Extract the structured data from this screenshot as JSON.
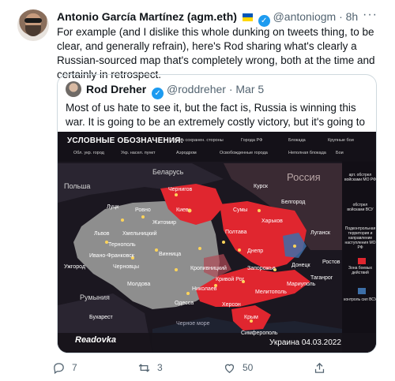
{
  "tweet": {
    "author_name": "Antonio García Martínez (agm.eth)",
    "handle": "@antoniogm",
    "separator": "·",
    "time": "8h",
    "body": "For example (and I dislike this whole dunking on tweets thing, to be clear, and generally refrain), here's Rod sharing what's clearly a Russian-sourced map that's completely wrong, both at the time and certainly in retrospect."
  },
  "quote": {
    "author_name": "Rod Dreher",
    "handle": "@roddreher",
    "separator": "·",
    "time": "Mar 5",
    "body": "Most of us hate to see it, but the fact is, Russia is winning this war. It is going to be an extremely costly victory, but it's going to be a victory."
  },
  "map": {
    "legend_title": "УСЛОВНЫЕ ОБОЗНАЧЕНИЯ:",
    "legend": {
      "l1": "Города сохранен. стороны",
      "l2": "Города РФ",
      "l3": "Блокада",
      "l4": "Крупные бои",
      "l5": "Обл. укр. город",
      "l6": "Укр. насел. пункт",
      "l7": "Аэродром",
      "l8": "Освобожденные города",
      "l9": "Неполная блокада",
      "l10": "Бои"
    },
    "labels": {
      "belarus": "Беларусь",
      "poland": "Польша",
      "russia": "Россия",
      "romania": "Румыния",
      "moldova": "Молдова",
      "bucharest": "Бухарест",
      "kiev": "Киев",
      "chernigov": "Чернигов",
      "kursk": "Курск",
      "belgorod": "Белгород",
      "kharkov": "Харьков",
      "lugansk": "Луганск",
      "donetsk": "Донецк",
      "rostov": "Ростов",
      "taganrog": "Таганрог",
      "lutsk": "Луцк",
      "rovno": "Ровно",
      "zhitomir": "Житомир",
      "lvov": "Львов",
      "ternopol": "Тернополь",
      "vinnitsa": "Винница",
      "khmelnitsky": "Хмельницкий",
      "ivanofrankovsk": "Ивано-Франковск",
      "chernovtsy": "Черновцы",
      "uzhgorod": "Ужгород",
      "poltava": "Полтава",
      "sumy": "Сумы",
      "kropivnitsky": "Кропивницкий",
      "dnepr": "Днепр",
      "zaporozhye": "Запорожье",
      "krivoyrog": "Кривой Рог",
      "nikolaev": "Николаев",
      "odessa": "Одесса",
      "kherson": "Херсон",
      "melitopol": "Мелитополь",
      "mariupol": "Мариуполь",
      "simferopol": "Симферополь",
      "krym": "Крым",
      "chernoe_more": "Черное море"
    },
    "sidebar": {
      "s1": "арт. обстрел войсками МО РФ",
      "s2": "обстрел войсками ВСУ",
      "s3": "Подконтрольная территория и направление наступления МО РФ",
      "s4": "Зона боевых действий",
      "s5": "контроль сил ВСУ"
    },
    "brand": "Readovka",
    "date": "Украина 04.03.2022",
    "colors": {
      "ukraine": "#8e8e8e",
      "russia_control": "#e0262f",
      "background": "#1b1720"
    }
  },
  "actions": {
    "replies": "7",
    "retweets": "3",
    "likes": "50"
  }
}
